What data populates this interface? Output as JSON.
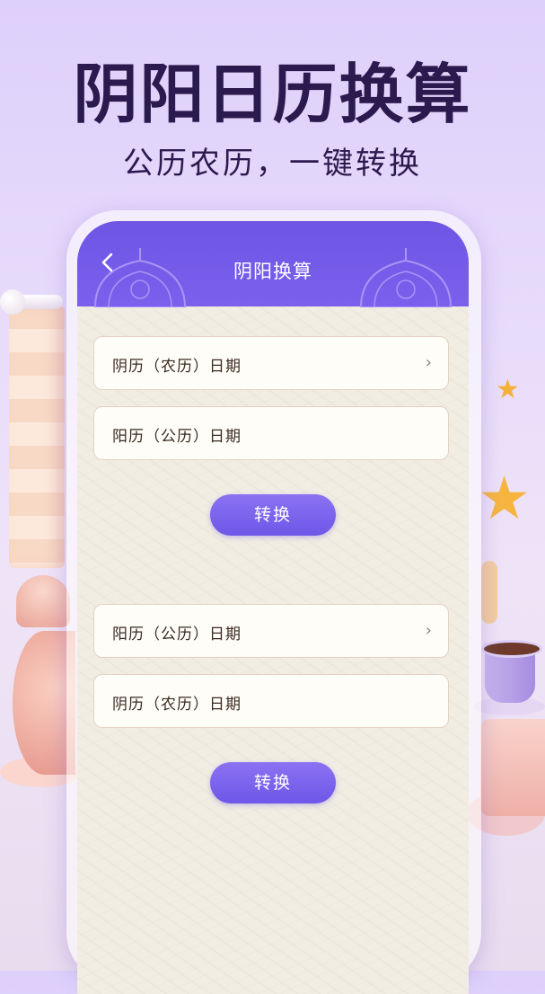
{
  "promo": {
    "title": "阴阳日历换算",
    "subtitle": "公历农历，一键转换"
  },
  "header": {
    "title": "阴阳换算",
    "back_icon": "chevron-left-icon",
    "color": "#7059e6"
  },
  "section1": {
    "input_label": "阴历（农历）日期",
    "output_label": "阳历（公历）日期",
    "button_label": "转换"
  },
  "section2": {
    "input_label": "阳历（公历）日期",
    "output_label": "阴历（农历）日期",
    "button_label": "转换"
  },
  "chevron_glyph": "›",
  "colors": {
    "accent": "#7059e6",
    "title_text": "#2b1a4e",
    "field_border": "#e4d2c2"
  }
}
